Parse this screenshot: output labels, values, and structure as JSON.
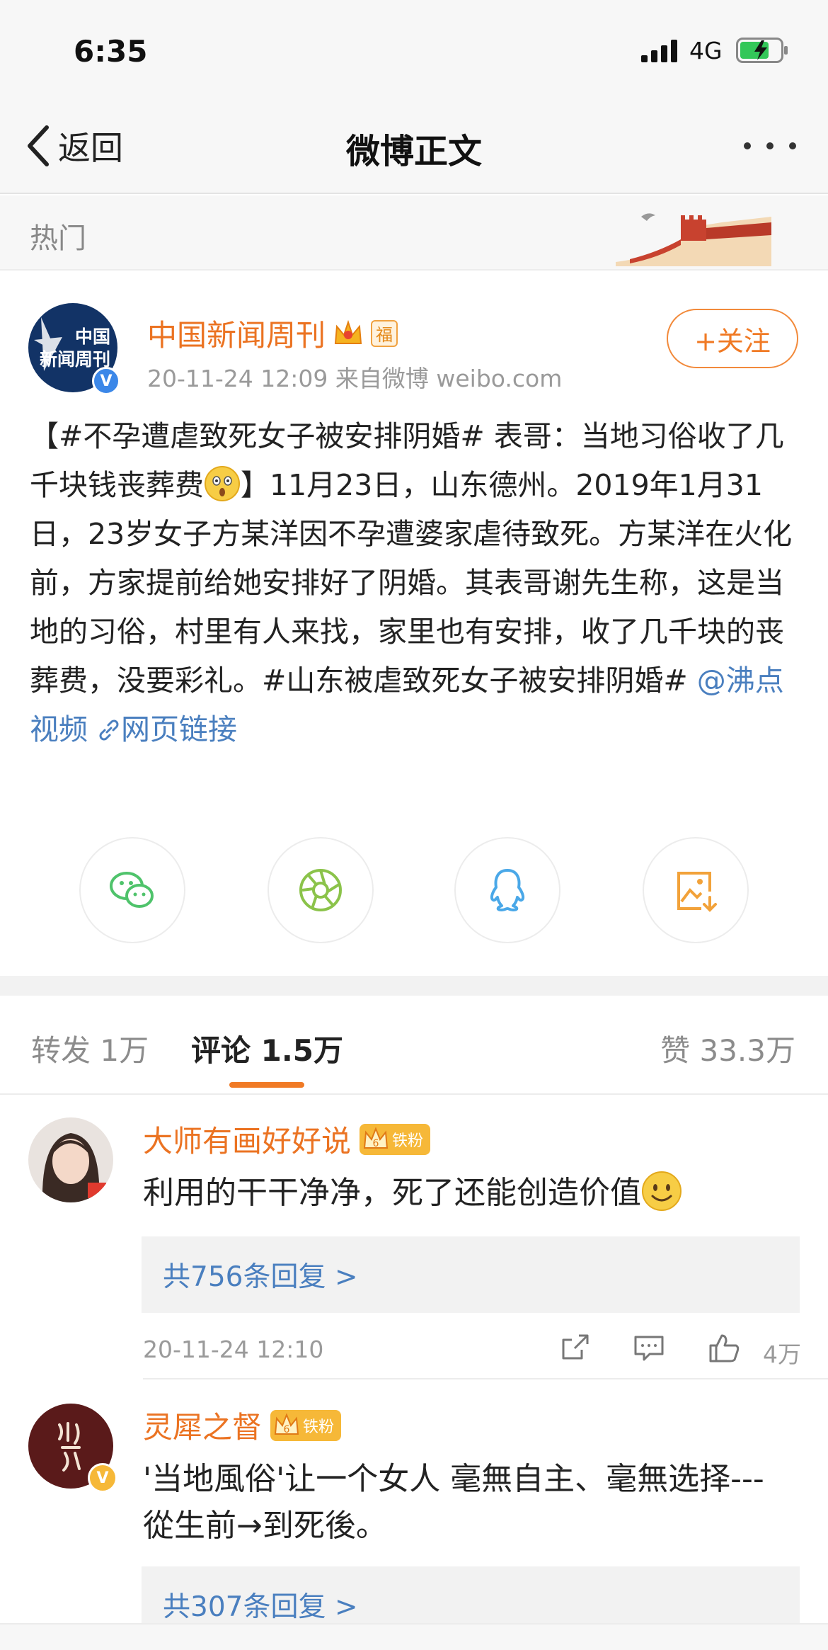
{
  "status_bar": {
    "time": "6:35",
    "network": "4G"
  },
  "nav": {
    "back_label": "返回",
    "title": "微博正文"
  },
  "hot": {
    "label": "热门"
  },
  "post": {
    "author": "中国新闻周刊",
    "avatar_text_1": "中国",
    "avatar_text_2": "新闻周刊",
    "badge_text": "福",
    "meta": "20-11-24 12:09  来自微博 weibo.com",
    "follow_label": "+关注",
    "text_part1": "【#不孕遭虐致死女子被安排阴婚# 表哥：当地习俗收了几千块钱丧葬费",
    "text_part2": "】11月23日，山东德州。2019年1月31日，23岁女子方某洋因不孕遭婆家虐待致死。方某洋在火化前，方家提前给她安排好了阴婚。其表哥谢先生称，这是当地的习俗，村里有人来找，家里也有安排，收了几千块的丧葬费，没要彩礼。#山东被虐致死女子被安排阴婚# ",
    "mention": "@沸点视频",
    "web_link": "网页链接"
  },
  "share_icons": [
    "wechat-icon",
    "moments-icon",
    "qq-icon",
    "save-image-icon"
  ],
  "tabs": {
    "repost": "转发 1万",
    "comment": "评论 1.5万",
    "like": "赞 33.3万"
  },
  "comments": [
    {
      "name": "大师有画好好说",
      "fan_badge": "铁粉",
      "text": "利用的干干净净，死了还能创造价值",
      "replies": "共756条回复 >",
      "time": "20-11-24 12:10",
      "likes": "4万"
    },
    {
      "name": "灵犀之督",
      "fan_badge": "铁粉",
      "text": "'当地風俗'让一个女人 毫無自主、毫無选择---從生前→到死後。",
      "replies": "共307条回复 >"
    }
  ],
  "colors": {
    "accent_orange": "#eb7322",
    "link_blue": "#4a7fbf"
  }
}
